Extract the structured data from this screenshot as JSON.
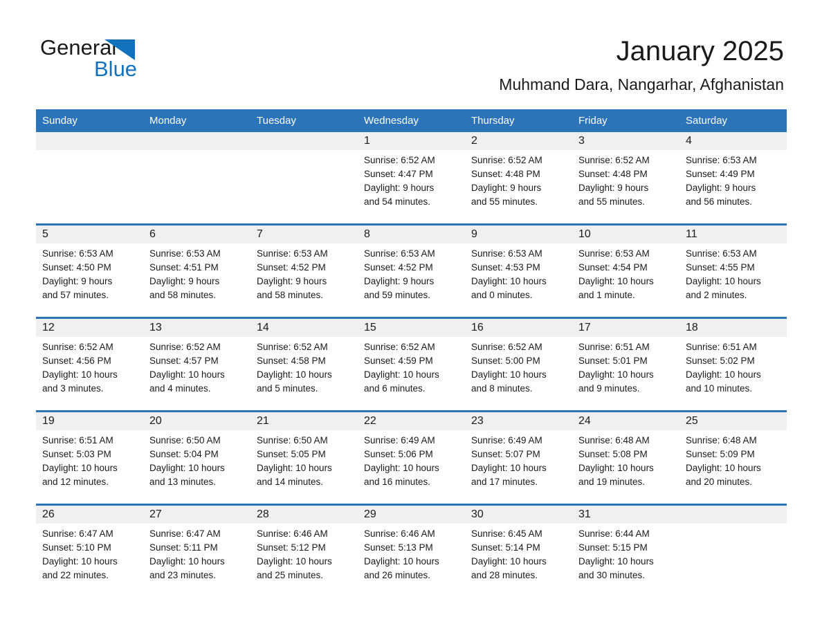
{
  "brand": {
    "name_part1": "General",
    "name_part2": "Blue",
    "accent_color": "#1272bb",
    "triangle_icon": "logo-triangle-icon"
  },
  "header": {
    "title": "January 2025",
    "subtitle": "Muhmand Dara, Nangarhar, Afghanistan"
  },
  "calendar": {
    "header_bg": "#2b74b8",
    "daynum_bg": "#f0f0f0",
    "weekday_headers": [
      "Sunday",
      "Monday",
      "Tuesday",
      "Wednesday",
      "Thursday",
      "Friday",
      "Saturday"
    ],
    "weeks": [
      [
        {
          "day": "",
          "blank": true
        },
        {
          "day": "",
          "blank": true
        },
        {
          "day": "",
          "blank": true
        },
        {
          "day": "1",
          "sunrise": "Sunrise: 6:52 AM",
          "sunset": "Sunset: 4:47 PM",
          "daylight_line1": "Daylight: 9 hours",
          "daylight_line2": "and 54 minutes."
        },
        {
          "day": "2",
          "sunrise": "Sunrise: 6:52 AM",
          "sunset": "Sunset: 4:48 PM",
          "daylight_line1": "Daylight: 9 hours",
          "daylight_line2": "and 55 minutes."
        },
        {
          "day": "3",
          "sunrise": "Sunrise: 6:52 AM",
          "sunset": "Sunset: 4:48 PM",
          "daylight_line1": "Daylight: 9 hours",
          "daylight_line2": "and 55 minutes."
        },
        {
          "day": "4",
          "sunrise": "Sunrise: 6:53 AM",
          "sunset": "Sunset: 4:49 PM",
          "daylight_line1": "Daylight: 9 hours",
          "daylight_line2": "and 56 minutes."
        }
      ],
      [
        {
          "day": "5",
          "sunrise": "Sunrise: 6:53 AM",
          "sunset": "Sunset: 4:50 PM",
          "daylight_line1": "Daylight: 9 hours",
          "daylight_line2": "and 57 minutes."
        },
        {
          "day": "6",
          "sunrise": "Sunrise: 6:53 AM",
          "sunset": "Sunset: 4:51 PM",
          "daylight_line1": "Daylight: 9 hours",
          "daylight_line2": "and 58 minutes."
        },
        {
          "day": "7",
          "sunrise": "Sunrise: 6:53 AM",
          "sunset": "Sunset: 4:52 PM",
          "daylight_line1": "Daylight: 9 hours",
          "daylight_line2": "and 58 minutes."
        },
        {
          "day": "8",
          "sunrise": "Sunrise: 6:53 AM",
          "sunset": "Sunset: 4:52 PM",
          "daylight_line1": "Daylight: 9 hours",
          "daylight_line2": "and 59 minutes."
        },
        {
          "day": "9",
          "sunrise": "Sunrise: 6:53 AM",
          "sunset": "Sunset: 4:53 PM",
          "daylight_line1": "Daylight: 10 hours",
          "daylight_line2": "and 0 minutes."
        },
        {
          "day": "10",
          "sunrise": "Sunrise: 6:53 AM",
          "sunset": "Sunset: 4:54 PM",
          "daylight_line1": "Daylight: 10 hours",
          "daylight_line2": "and 1 minute."
        },
        {
          "day": "11",
          "sunrise": "Sunrise: 6:53 AM",
          "sunset": "Sunset: 4:55 PM",
          "daylight_line1": "Daylight: 10 hours",
          "daylight_line2": "and 2 minutes."
        }
      ],
      [
        {
          "day": "12",
          "sunrise": "Sunrise: 6:52 AM",
          "sunset": "Sunset: 4:56 PM",
          "daylight_line1": "Daylight: 10 hours",
          "daylight_line2": "and 3 minutes."
        },
        {
          "day": "13",
          "sunrise": "Sunrise: 6:52 AM",
          "sunset": "Sunset: 4:57 PM",
          "daylight_line1": "Daylight: 10 hours",
          "daylight_line2": "and 4 minutes."
        },
        {
          "day": "14",
          "sunrise": "Sunrise: 6:52 AM",
          "sunset": "Sunset: 4:58 PM",
          "daylight_line1": "Daylight: 10 hours",
          "daylight_line2": "and 5 minutes."
        },
        {
          "day": "15",
          "sunrise": "Sunrise: 6:52 AM",
          "sunset": "Sunset: 4:59 PM",
          "daylight_line1": "Daylight: 10 hours",
          "daylight_line2": "and 6 minutes."
        },
        {
          "day": "16",
          "sunrise": "Sunrise: 6:52 AM",
          "sunset": "Sunset: 5:00 PM",
          "daylight_line1": "Daylight: 10 hours",
          "daylight_line2": "and 8 minutes."
        },
        {
          "day": "17",
          "sunrise": "Sunrise: 6:51 AM",
          "sunset": "Sunset: 5:01 PM",
          "daylight_line1": "Daylight: 10 hours",
          "daylight_line2": "and 9 minutes."
        },
        {
          "day": "18",
          "sunrise": "Sunrise: 6:51 AM",
          "sunset": "Sunset: 5:02 PM",
          "daylight_line1": "Daylight: 10 hours",
          "daylight_line2": "and 10 minutes."
        }
      ],
      [
        {
          "day": "19",
          "sunrise": "Sunrise: 6:51 AM",
          "sunset": "Sunset: 5:03 PM",
          "daylight_line1": "Daylight: 10 hours",
          "daylight_line2": "and 12 minutes."
        },
        {
          "day": "20",
          "sunrise": "Sunrise: 6:50 AM",
          "sunset": "Sunset: 5:04 PM",
          "daylight_line1": "Daylight: 10 hours",
          "daylight_line2": "and 13 minutes."
        },
        {
          "day": "21",
          "sunrise": "Sunrise: 6:50 AM",
          "sunset": "Sunset: 5:05 PM",
          "daylight_line1": "Daylight: 10 hours",
          "daylight_line2": "and 14 minutes."
        },
        {
          "day": "22",
          "sunrise": "Sunrise: 6:49 AM",
          "sunset": "Sunset: 5:06 PM",
          "daylight_line1": "Daylight: 10 hours",
          "daylight_line2": "and 16 minutes."
        },
        {
          "day": "23",
          "sunrise": "Sunrise: 6:49 AM",
          "sunset": "Sunset: 5:07 PM",
          "daylight_line1": "Daylight: 10 hours",
          "daylight_line2": "and 17 minutes."
        },
        {
          "day": "24",
          "sunrise": "Sunrise: 6:48 AM",
          "sunset": "Sunset: 5:08 PM",
          "daylight_line1": "Daylight: 10 hours",
          "daylight_line2": "and 19 minutes."
        },
        {
          "day": "25",
          "sunrise": "Sunrise: 6:48 AM",
          "sunset": "Sunset: 5:09 PM",
          "daylight_line1": "Daylight: 10 hours",
          "daylight_line2": "and 20 minutes."
        }
      ],
      [
        {
          "day": "26",
          "sunrise": "Sunrise: 6:47 AM",
          "sunset": "Sunset: 5:10 PM",
          "daylight_line1": "Daylight: 10 hours",
          "daylight_line2": "and 22 minutes."
        },
        {
          "day": "27",
          "sunrise": "Sunrise: 6:47 AM",
          "sunset": "Sunset: 5:11 PM",
          "daylight_line1": "Daylight: 10 hours",
          "daylight_line2": "and 23 minutes."
        },
        {
          "day": "28",
          "sunrise": "Sunrise: 6:46 AM",
          "sunset": "Sunset: 5:12 PM",
          "daylight_line1": "Daylight: 10 hours",
          "daylight_line2": "and 25 minutes."
        },
        {
          "day": "29",
          "sunrise": "Sunrise: 6:46 AM",
          "sunset": "Sunset: 5:13 PM",
          "daylight_line1": "Daylight: 10 hours",
          "daylight_line2": "and 26 minutes."
        },
        {
          "day": "30",
          "sunrise": "Sunrise: 6:45 AM",
          "sunset": "Sunset: 5:14 PM",
          "daylight_line1": "Daylight: 10 hours",
          "daylight_line2": "and 28 minutes."
        },
        {
          "day": "31",
          "sunrise": "Sunrise: 6:44 AM",
          "sunset": "Sunset: 5:15 PM",
          "daylight_line1": "Daylight: 10 hours",
          "daylight_line2": "and 30 minutes."
        },
        {
          "day": "",
          "blank": true
        }
      ]
    ]
  }
}
